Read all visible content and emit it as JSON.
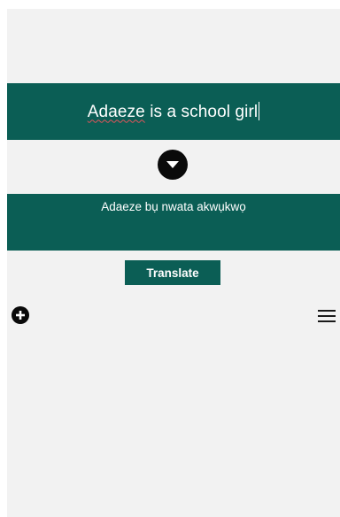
{
  "colors": {
    "panel": "#0b5e55",
    "background": "#f2f2f2",
    "icon": "#0a0a0a",
    "spellcheck_underline": "#e3545a"
  },
  "source": {
    "misspelled_word": "Adaeze",
    "rest": " is a school girl"
  },
  "target": {
    "text": "Adaeze bụ nwata akwụkwọ"
  },
  "translate_button": {
    "label": "Translate"
  },
  "icons": {
    "swap": "chevron-down-circle-icon",
    "add": "add-circle-icon",
    "menu": "hamburger-menu-icon"
  }
}
